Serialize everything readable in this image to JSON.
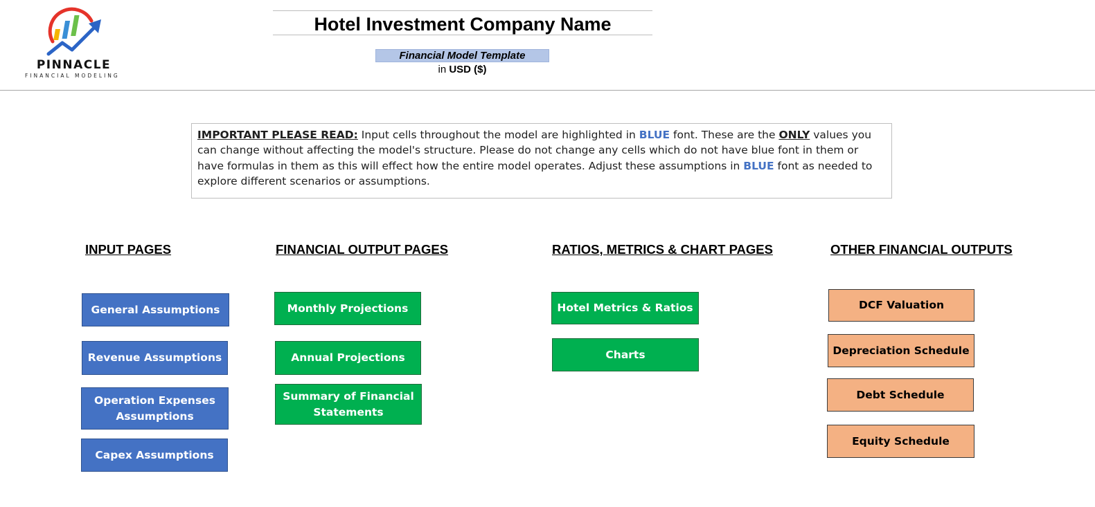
{
  "header": {
    "logo_name": "PINNACLE",
    "logo_tagline": "FINANCIAL MODELING",
    "company_name": "Hotel Investment Company Name",
    "template_label": "Financial Model Template",
    "currency_prefix": "in",
    "currency": "USD ($)"
  },
  "notice": {
    "lead": "IMPORTANT PLEASE READ:",
    "text_1": " Input cells throughout the model are highlighted in ",
    "blue_1": "BLUE",
    "text_2": " font. These are the ",
    "only": "ONLY",
    "text_3": " values you can change without affecting the model's structure. Please do not change any cells which do not have blue font in them or have formulas in them as this will effect how the entire model operates. Adjust these assumptions in ",
    "blue_2": "BLUE",
    "text_4": " font as needed to explore different scenarios or assumptions."
  },
  "sections": {
    "input": {
      "heading": "INPUT PAGES",
      "buttons": [
        "General Assumptions",
        "Revenue Assumptions",
        "Operation Expenses Assumptions",
        "Capex Assumptions"
      ]
    },
    "financial_output": {
      "heading": "FINANCIAL OUTPUT PAGES",
      "buttons": [
        "Monthly Projections",
        "Annual Projections",
        "Summary of Financial Statements"
      ]
    },
    "ratios": {
      "heading": "RATIOS, METRICS & CHART PAGES",
      "buttons": [
        "Hotel Metrics & Ratios",
        "Charts"
      ]
    },
    "other": {
      "heading": "OTHER FINANCIAL OUTPUTS",
      "buttons": [
        "DCF Valuation",
        "Depreciation Schedule",
        "Debt Schedule",
        "Equity Schedule"
      ]
    }
  },
  "colors": {
    "input_button": "#4472c4",
    "output_button": "#00b050",
    "other_button": "#f4b183",
    "highlight_blue": "#4472c4",
    "template_label_bg": "#b4c6e7"
  },
  "icons": {
    "logo": "pinnacle-logo-icon"
  }
}
